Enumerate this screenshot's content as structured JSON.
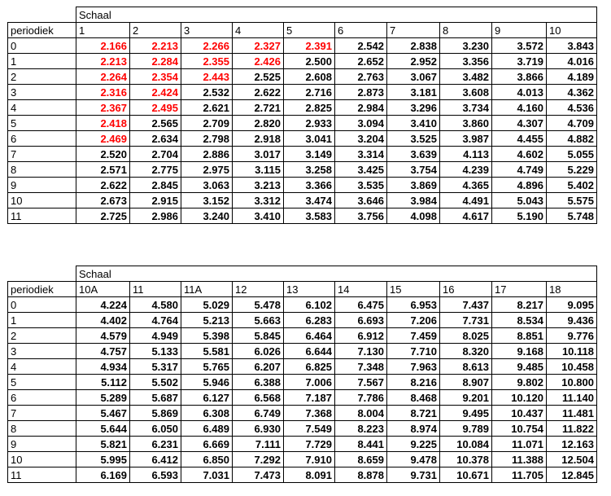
{
  "table1": {
    "group_label": "Schaal",
    "row_label": "periodiek",
    "columns": [
      "1",
      "2",
      "3",
      "4",
      "5",
      "6",
      "7",
      "8",
      "9",
      "10"
    ],
    "rows": [
      {
        "periodiek": "0",
        "values": [
          "2.166",
          "2.213",
          "2.266",
          "2.327",
          "2.391",
          "2.542",
          "2.838",
          "3.230",
          "3.572",
          "3.843"
        ]
      },
      {
        "periodiek": "1",
        "values": [
          "2.213",
          "2.284",
          "2.355",
          "2.426",
          "2.500",
          "2.652",
          "2.952",
          "3.356",
          "3.719",
          "4.016"
        ]
      },
      {
        "periodiek": "2",
        "values": [
          "2.264",
          "2.354",
          "2.443",
          "2.525",
          "2.608",
          "2.763",
          "3.067",
          "3.482",
          "3.866",
          "4.189"
        ]
      },
      {
        "periodiek": "3",
        "values": [
          "2.316",
          "2.424",
          "2.532",
          "2.622",
          "2.716",
          "2.873",
          "3.181",
          "3.608",
          "4.013",
          "4.362"
        ]
      },
      {
        "periodiek": "4",
        "values": [
          "2.367",
          "2.495",
          "2.621",
          "2.721",
          "2.825",
          "2.984",
          "3.296",
          "3.734",
          "4.160",
          "4.536"
        ]
      },
      {
        "periodiek": "5",
        "values": [
          "2.418",
          "2.565",
          "2.709",
          "2.820",
          "2.933",
          "3.094",
          "3.410",
          "3.860",
          "4.307",
          "4.709"
        ]
      },
      {
        "periodiek": "6",
        "values": [
          "2.469",
          "2.634",
          "2.798",
          "2.918",
          "3.041",
          "3.204",
          "3.525",
          "3.987",
          "4.455",
          "4.882"
        ]
      },
      {
        "periodiek": "7",
        "values": [
          "2.520",
          "2.704",
          "2.886",
          "3.017",
          "3.149",
          "3.314",
          "3.639",
          "4.113",
          "4.602",
          "5.055"
        ]
      },
      {
        "periodiek": "8",
        "values": [
          "2.571",
          "2.775",
          "2.975",
          "3.115",
          "3.258",
          "3.425",
          "3.754",
          "4.239",
          "4.749",
          "5.229"
        ]
      },
      {
        "periodiek": "9",
        "values": [
          "2.622",
          "2.845",
          "3.063",
          "3.213",
          "3.366",
          "3.535",
          "3.869",
          "4.365",
          "4.896",
          "5.402"
        ]
      },
      {
        "periodiek": "10",
        "values": [
          "2.673",
          "2.915",
          "3.152",
          "3.312",
          "3.474",
          "3.646",
          "3.984",
          "4.491",
          "5.043",
          "5.575"
        ]
      },
      {
        "periodiek": "11",
        "values": [
          "2.725",
          "2.986",
          "3.240",
          "3.410",
          "3.583",
          "3.756",
          "4.098",
          "4.617",
          "5.190",
          "5.748"
        ]
      }
    ],
    "highlight_color": "#ff0000",
    "highlighted_cells": [
      [
        0,
        0
      ],
      [
        0,
        1
      ],
      [
        0,
        2
      ],
      [
        0,
        3
      ],
      [
        0,
        4
      ],
      [
        1,
        0
      ],
      [
        1,
        1
      ],
      [
        1,
        2
      ],
      [
        1,
        3
      ],
      [
        2,
        0
      ],
      [
        2,
        1
      ],
      [
        2,
        2
      ],
      [
        3,
        0
      ],
      [
        3,
        1
      ],
      [
        4,
        0
      ],
      [
        4,
        1
      ],
      [
        5,
        0
      ],
      [
        6,
        0
      ]
    ]
  },
  "table2": {
    "group_label": "Schaal",
    "row_label": "periodiek",
    "columns": [
      "10A",
      "11",
      "11A",
      "12",
      "13",
      "14",
      "15",
      "16",
      "17",
      "18"
    ],
    "rows": [
      {
        "periodiek": "0",
        "values": [
          "4.224",
          "4.580",
          "5.029",
          "5.478",
          "6.102",
          "6.475",
          "6.953",
          "7.437",
          "8.217",
          "9.095"
        ]
      },
      {
        "periodiek": "1",
        "values": [
          "4.402",
          "4.764",
          "5.213",
          "5.663",
          "6.283",
          "6.693",
          "7.206",
          "7.731",
          "8.534",
          "9.436"
        ]
      },
      {
        "periodiek": "2",
        "values": [
          "4.579",
          "4.949",
          "5.398",
          "5.845",
          "6.464",
          "6.912",
          "7.459",
          "8.025",
          "8.851",
          "9.776"
        ]
      },
      {
        "periodiek": "3",
        "values": [
          "4.757",
          "5.133",
          "5.581",
          "6.026",
          "6.644",
          "7.130",
          "7.710",
          "8.320",
          "9.168",
          "10.118"
        ]
      },
      {
        "periodiek": "4",
        "values": [
          "4.934",
          "5.317",
          "5.765",
          "6.207",
          "6.825",
          "7.348",
          "7.963",
          "8.613",
          "9.485",
          "10.458"
        ]
      },
      {
        "periodiek": "5",
        "values": [
          "5.112",
          "5.502",
          "5.946",
          "6.388",
          "7.006",
          "7.567",
          "8.216",
          "8.907",
          "9.802",
          "10.800"
        ]
      },
      {
        "periodiek": "6",
        "values": [
          "5.289",
          "5.687",
          "6.127",
          "6.568",
          "7.187",
          "7.786",
          "8.468",
          "9.201",
          "10.120",
          "11.140"
        ]
      },
      {
        "periodiek": "7",
        "values": [
          "5.467",
          "5.869",
          "6.308",
          "6.749",
          "7.368",
          "8.004",
          "8.721",
          "9.495",
          "10.437",
          "11.481"
        ]
      },
      {
        "periodiek": "8",
        "values": [
          "5.644",
          "6.050",
          "6.489",
          "6.930",
          "7.549",
          "8.223",
          "8.974",
          "9.789",
          "10.754",
          "11.822"
        ]
      },
      {
        "periodiek": "9",
        "values": [
          "5.821",
          "6.231",
          "6.669",
          "7.111",
          "7.729",
          "8.441",
          "9.225",
          "10.084",
          "11.071",
          "12.163"
        ]
      },
      {
        "periodiek": "10",
        "values": [
          "5.995",
          "6.412",
          "6.850",
          "7.292",
          "7.910",
          "8.659",
          "9.478",
          "10.378",
          "11.388",
          "12.504"
        ]
      },
      {
        "periodiek": "11",
        "values": [
          "6.169",
          "6.593",
          "7.031",
          "7.473",
          "8.091",
          "8.878",
          "9.731",
          "10.671",
          "11.705",
          "12.845"
        ]
      }
    ]
  }
}
